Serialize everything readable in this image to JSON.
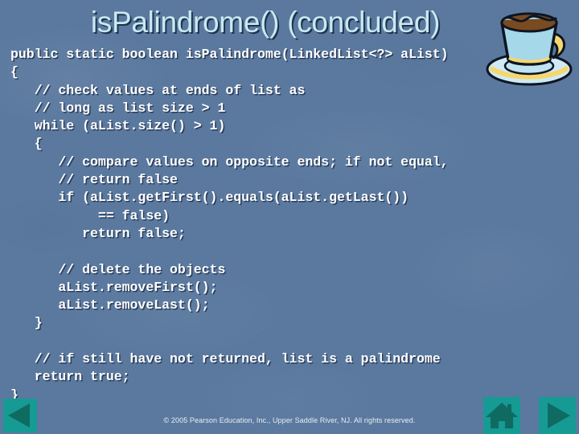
{
  "slide": {
    "title": "isPalindrome() (concluded)",
    "background_color": "#5b799f",
    "title_color": "#c9e9f2",
    "code_color": "#ffffff",
    "accent_color": "#169a94"
  },
  "code_lines": [
    "public static boolean isPalindrome(LinkedList<?> aList)",
    "{",
    "   // check values at ends of list as",
    "   // long as list size > 1",
    "   while (aList.size() > 1)",
    "   {",
    "      // compare values on opposite ends; if not equal,",
    "      // return false",
    "      if (aList.getFirst().equals(aList.getLast())",
    "           == false)",
    "         return false;",
    "",
    "      // delete the objects",
    "      aList.removeFirst();",
    "      aList.removeLast();",
    "   }",
    "",
    "   // if still have not returned, list is a palindrome",
    "   return true;",
    "}"
  ],
  "footer": {
    "copyright": "© 2005 Pearson Education, Inc., Upper Saddle River, NJ.  All rights reserved."
  },
  "nav": {
    "previous_label": "Previous slide",
    "home_label": "Home",
    "next_label": "Next slide"
  },
  "decoration": {
    "cup_label": "coffee-cup-illustration",
    "cup_body_color": "#a5d8e8",
    "cup_handle_color": "#f5d76e",
    "coffee_color": "#7a4a20"
  }
}
